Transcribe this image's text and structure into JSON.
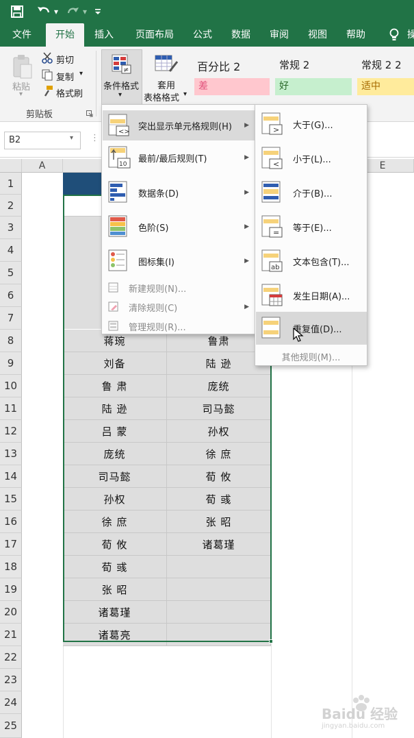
{
  "ribbon_tabs": [
    "文件",
    "开始",
    "插入",
    "页面布局",
    "公式",
    "数据",
    "审阅",
    "视图",
    "帮助",
    "操"
  ],
  "active_tab": "开始",
  "clipboard": {
    "paste_label": "粘贴",
    "cut_label": "剪切",
    "copy_label": "复制",
    "format_painter_label": "格式刷",
    "group_label": "剪贴板"
  },
  "conditional_format": {
    "label": "条件格式"
  },
  "table_format": {
    "label_line1": "套用",
    "label_line2": "表格格式"
  },
  "styles": {
    "titles": [
      "百分比 2",
      "常规 2",
      "常规 2 2"
    ],
    "boxes": [
      {
        "label": "差",
        "bg": "#ffc7ce",
        "fg": "#e0507a"
      },
      {
        "label": "好",
        "bg": "#c6efce",
        "fg": "#2b6a2b"
      },
      {
        "label": "适中",
        "bg": "#ffeb9c",
        "fg": "#a66a00"
      }
    ]
  },
  "name_box": "B2",
  "columns": [
    "A",
    "E"
  ],
  "row_numbers": [
    "1",
    "2",
    "3",
    "4",
    "5",
    "6",
    "7",
    "8",
    "9",
    "10",
    "11",
    "12",
    "13",
    "14",
    "15",
    "16",
    "17",
    "18",
    "19",
    "20",
    "21",
    "22",
    "23",
    "24",
    "25"
  ],
  "visible_rows": [
    {
      "row": "8",
      "b": "蒋琬",
      "c": "鲁肃"
    },
    {
      "row": "9",
      "b": "刘备",
      "c": "陆 逊"
    },
    {
      "row": "10",
      "b": "鲁 肃",
      "c": "庞统"
    },
    {
      "row": "11",
      "b": "陆 逊",
      "c": "司马懿"
    },
    {
      "row": "12",
      "b": "吕 蒙",
      "c": "孙权"
    },
    {
      "row": "13",
      "b": "庞统",
      "c": "徐 庶"
    },
    {
      "row": "14",
      "b": "司马懿",
      "c": "荀 攸"
    },
    {
      "row": "15",
      "b": "孙权",
      "c": "荀 彧"
    },
    {
      "row": "16",
      "b": "徐 庶",
      "c": "张 昭"
    },
    {
      "row": "17",
      "b": "荀 攸",
      "c": "诸葛瑾"
    },
    {
      "row": "18",
      "b": "荀 彧",
      "c": ""
    },
    {
      "row": "19",
      "b": "张 昭",
      "c": ""
    },
    {
      "row": "20",
      "b": "诸葛瑾",
      "c": ""
    },
    {
      "row": "21",
      "b": "诸葛亮",
      "c": ""
    }
  ],
  "menu": {
    "items": [
      {
        "label": "突出显示单元格规则(H)",
        "icon": "highlight-rules-icon",
        "has_submenu": true,
        "highlighted": true
      },
      {
        "label": "最前/最后规则(T)",
        "icon": "top-bottom-rules-icon",
        "has_submenu": true
      },
      {
        "label": "数据条(D)",
        "icon": "data-bars-icon",
        "has_submenu": true
      },
      {
        "label": "色阶(S)",
        "icon": "color-scales-icon",
        "has_submenu": true
      },
      {
        "label": "图标集(I)",
        "icon": "icon-sets-icon",
        "has_submenu": true
      }
    ],
    "small_items": [
      {
        "label": "新建规则(N)...",
        "icon": "new-rule-icon",
        "has_submenu": false
      },
      {
        "label": "清除规则(C)",
        "icon": "clear-rules-icon",
        "has_submenu": true
      },
      {
        "label": "管理规则(R)...",
        "icon": "manage-rules-icon",
        "has_submenu": false
      }
    ]
  },
  "submenu": {
    "items": [
      {
        "label": "大于(G)...",
        "icon": "greater-than-icon"
      },
      {
        "label": "小于(L)...",
        "icon": "less-than-icon"
      },
      {
        "label": "介于(B)...",
        "icon": "between-icon"
      },
      {
        "label": "等于(E)...",
        "icon": "equal-to-icon"
      },
      {
        "label": "文本包含(T)...",
        "icon": "text-contains-icon"
      },
      {
        "label": "发生日期(A)...",
        "icon": "date-occurring-icon"
      },
      {
        "label": "重复值(D)...",
        "icon": "duplicate-values-icon",
        "highlighted": true
      }
    ],
    "more_label": "其他规则(M)..."
  },
  "watermark": {
    "text": "Baidu 经验",
    "url_text": "jingyan.baidu.com"
  },
  "colors": {
    "excel_green": "#217346",
    "menu_highlight": "#dadada",
    "cell_fill": "#dedede"
  }
}
